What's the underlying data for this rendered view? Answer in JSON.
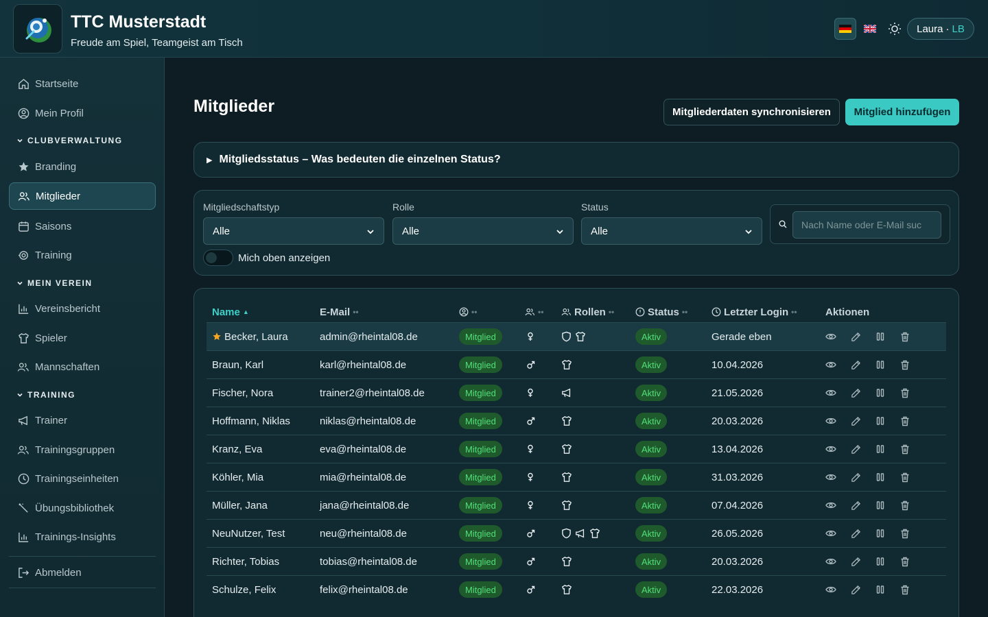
{
  "header": {
    "title": "TTC Musterstadt",
    "subtitle": "Freude am Spiel, Teamgeist am Tisch",
    "user_name": "Laura",
    "user_separator": "·",
    "user_initials": "LB"
  },
  "sidebar": {
    "items_top": [
      {
        "label": "Startseite",
        "icon": "home-icon"
      },
      {
        "label": "Mein Profil",
        "icon": "user-circle-icon"
      }
    ],
    "section_club": "CLUBVERWALTUNG",
    "items_club": [
      {
        "label": "Branding",
        "icon": "star-icon"
      },
      {
        "label": "Mitglieder",
        "icon": "users-icon"
      },
      {
        "label": "Saisons",
        "icon": "calendar-icon"
      },
      {
        "label": "Training",
        "icon": "target-icon"
      }
    ],
    "section_verein": "MEIN VEREIN",
    "items_verein": [
      {
        "label": "Vereinsbericht",
        "icon": "bar-chart-icon"
      },
      {
        "label": "Spieler",
        "icon": "shirt-icon"
      },
      {
        "label": "Mannschaften",
        "icon": "users-icon"
      }
    ],
    "section_training": "TRAINING",
    "items_training": [
      {
        "label": "Trainer",
        "icon": "megaphone-icon"
      },
      {
        "label": "Trainingsgruppen",
        "icon": "users-icon"
      },
      {
        "label": "Trainingseinheiten",
        "icon": "clock-icon"
      },
      {
        "label": "Übungsbibliothek",
        "icon": "wand-icon"
      },
      {
        "label": "Trainings-Insights",
        "icon": "bar-chart-icon"
      }
    ],
    "logout": "Abmelden"
  },
  "main": {
    "title": "Mitglieder",
    "sync_button": "Mitgliederdaten synchronisieren",
    "add_button": "Mitglied hinzufügen",
    "accordion_title": "Mitgliedsstatus – Was bedeuten die einzelnen Status?",
    "filters": {
      "type_label": "Mitgliedschaftstyp",
      "type_value": "Alle",
      "role_label": "Rolle",
      "role_value": "Alle",
      "status_label": "Status",
      "status_value": "Alle",
      "search_placeholder": "Nach Name oder E-Mail suc",
      "toggle_label": "Mich oben anzeigen"
    },
    "table": {
      "headers": {
        "name": "Name",
        "email": "E-Mail",
        "roles": "Rollen",
        "status": "Status",
        "last_login": "Letzter Login",
        "actions": "Aktionen"
      },
      "rows": [
        {
          "name": "Becker, Laura",
          "email": "admin@rheintal08.de",
          "type": "Mitglied",
          "gender": "female",
          "roles": [
            "shield",
            "shirt"
          ],
          "status": "Aktiv",
          "login": "Gerade eben",
          "starred": true
        },
        {
          "name": "Braun, Karl",
          "email": "karl@rheintal08.de",
          "type": "Mitglied",
          "gender": "male",
          "roles": [
            "shirt"
          ],
          "status": "Aktiv",
          "login": "10.04.2026"
        },
        {
          "name": "Fischer, Nora",
          "email": "trainer2@rheintal08.de",
          "type": "Mitglied",
          "gender": "female",
          "roles": [
            "megaphone"
          ],
          "status": "Aktiv",
          "login": "21.05.2026"
        },
        {
          "name": "Hoffmann, Niklas",
          "email": "niklas@rheintal08.de",
          "type": "Mitglied",
          "gender": "male",
          "roles": [
            "shirt"
          ],
          "status": "Aktiv",
          "login": "20.03.2026"
        },
        {
          "name": "Kranz, Eva",
          "email": "eva@rheintal08.de",
          "type": "Mitglied",
          "gender": "female",
          "roles": [
            "shirt"
          ],
          "status": "Aktiv",
          "login": "13.04.2026"
        },
        {
          "name": "Köhler, Mia",
          "email": "mia@rheintal08.de",
          "type": "Mitglied",
          "gender": "female",
          "roles": [
            "shirt"
          ],
          "status": "Aktiv",
          "login": "31.03.2026"
        },
        {
          "name": "Müller, Jana",
          "email": "jana@rheintal08.de",
          "type": "Mitglied",
          "gender": "female",
          "roles": [
            "shirt"
          ],
          "status": "Aktiv",
          "login": "07.04.2026"
        },
        {
          "name": "NeuNutzer, Test",
          "email": "neu@rheintal08.de",
          "type": "Mitglied",
          "gender": "male",
          "roles": [
            "shield",
            "megaphone",
            "shirt"
          ],
          "status": "Aktiv",
          "login": "26.05.2026"
        },
        {
          "name": "Richter, Tobias",
          "email": "tobias@rheintal08.de",
          "type": "Mitglied",
          "gender": "male",
          "roles": [
            "shirt"
          ],
          "status": "Aktiv",
          "login": "20.03.2026"
        },
        {
          "name": "Schulze, Felix",
          "email": "felix@rheintal08.de",
          "type": "Mitglied",
          "gender": "male",
          "roles": [
            "shirt"
          ],
          "status": "Aktiv",
          "login": "22.03.2026"
        }
      ]
    }
  },
  "colors": {
    "accent": "#3ac9c3",
    "badge_green_bg": "#1f5a2c",
    "badge_green_text": "#52e07a",
    "star": "#f5a623"
  }
}
